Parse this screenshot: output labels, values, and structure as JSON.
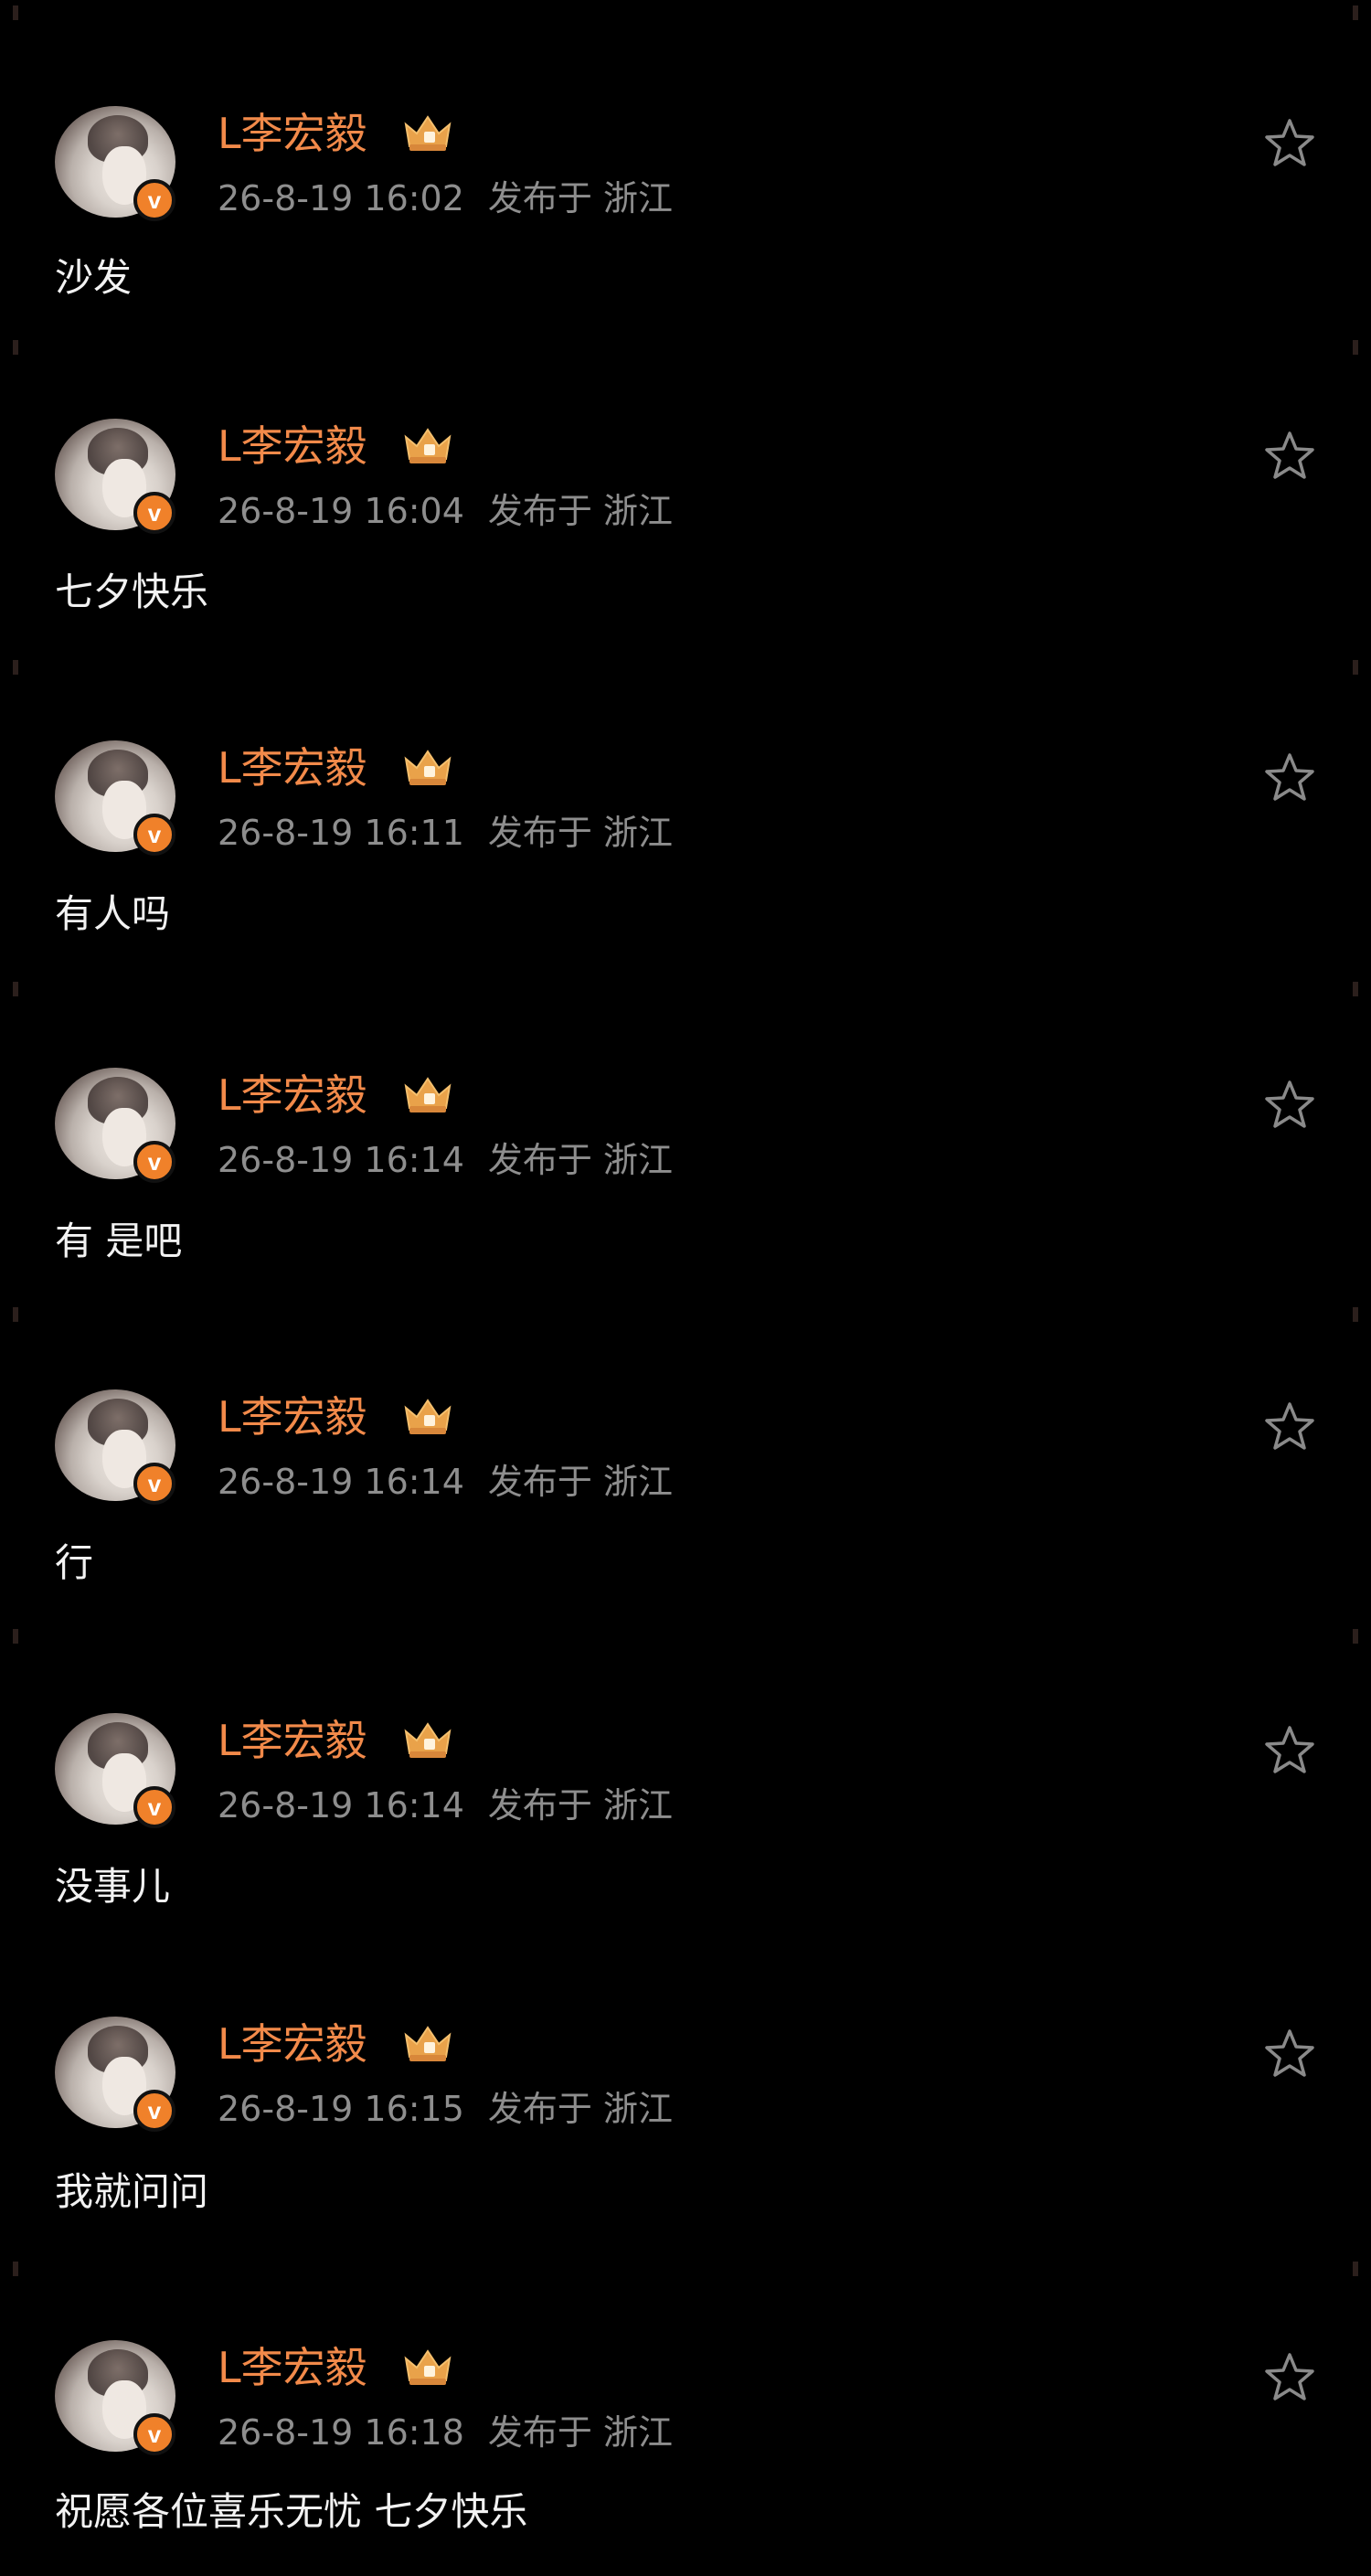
{
  "theme": {
    "background": "#000000",
    "name_color": "#f28a4a",
    "meta_color": "#8e8e8e",
    "text_color": "#f2f2f2",
    "badge_color": "#f0812a"
  },
  "icons": {
    "verified_badge": "v-badge-icon",
    "member_badge": "crown-icon",
    "favorite": "star-outline-icon"
  },
  "posts": [
    {
      "author": "L李宏毅",
      "badge_letter": "v",
      "time": "26-8-19 16:02",
      "location": "发布于 浙江",
      "text": "沙发"
    },
    {
      "author": "L李宏毅",
      "badge_letter": "v",
      "time": "26-8-19 16:04",
      "location": "发布于 浙江",
      "text": "七夕快乐"
    },
    {
      "author": "L李宏毅",
      "badge_letter": "v",
      "time": "26-8-19 16:11",
      "location": "发布于 浙江",
      "text": "有人吗"
    },
    {
      "author": "L李宏毅",
      "badge_letter": "v",
      "time": "26-8-19 16:14",
      "location": "发布于 浙江",
      "text": "有 是吧"
    },
    {
      "author": "L李宏毅",
      "badge_letter": "v",
      "time": "26-8-19 16:14",
      "location": "发布于 浙江",
      "text": "行"
    },
    {
      "author": "L李宏毅",
      "badge_letter": "v",
      "time": "26-8-19 16:14",
      "location": "发布于 浙江",
      "text": "没事儿"
    },
    {
      "author": "L李宏毅",
      "badge_letter": "v",
      "time": "26-8-19 16:15",
      "location": "发布于 浙江",
      "text": "我就问问"
    },
    {
      "author": "L李宏毅",
      "badge_letter": "v",
      "time": "26-8-19 16:18",
      "location": "发布于 浙江",
      "text": "祝愿各位喜乐无忧 七夕快乐"
    }
  ]
}
